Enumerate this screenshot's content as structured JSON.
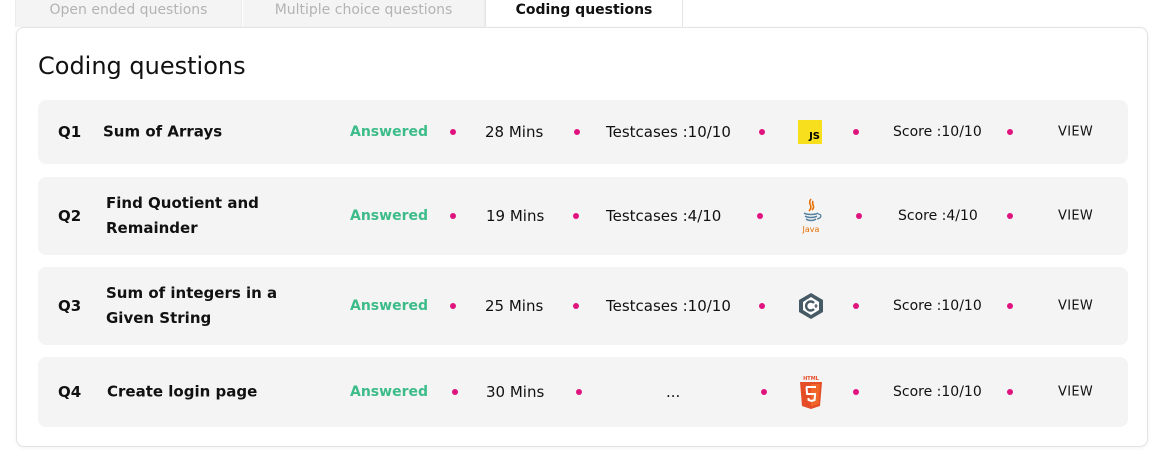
{
  "tabs": [
    {
      "label": "Open ended questions"
    },
    {
      "label": "Multiple choice questions"
    },
    {
      "label": "Coding questions"
    }
  ],
  "section_title": "Coding questions",
  "questions": [
    {
      "num": "Q1",
      "title": "Sum of Arrays",
      "status": "Answered",
      "time": "28 Mins",
      "testcases": "Testcases :10/10",
      "language_icon": "javascript-icon",
      "language_label": "JS",
      "score": "Score :10/10",
      "action": "VIEW"
    },
    {
      "num": "Q2",
      "title": "Find Quotient and Remainder",
      "status": "Answered",
      "time": "19 Mins",
      "testcases": "Testcases :4/10",
      "language_icon": "java-icon",
      "language_label": "Java",
      "score": "Score :4/10",
      "action": "VIEW"
    },
    {
      "num": "Q3",
      "title": "Sum of integers in a Given String",
      "status": "Answered",
      "time": "25 Mins",
      "testcases": "Testcases :10/10",
      "language_icon": "csharp-icon",
      "score": "Score :10/10",
      "action": "VIEW"
    },
    {
      "num": "Q4",
      "title": "Create login page",
      "status": "Answered",
      "time": "30 Mins",
      "testcases": "...",
      "language_icon": "html5-icon",
      "language_label": "HTML",
      "score": "Score :10/10",
      "action": "VIEW"
    }
  ],
  "colors": {
    "status": "#3cbc89",
    "dot": "#e0137e",
    "row_bg": "#f4f4f4"
  }
}
